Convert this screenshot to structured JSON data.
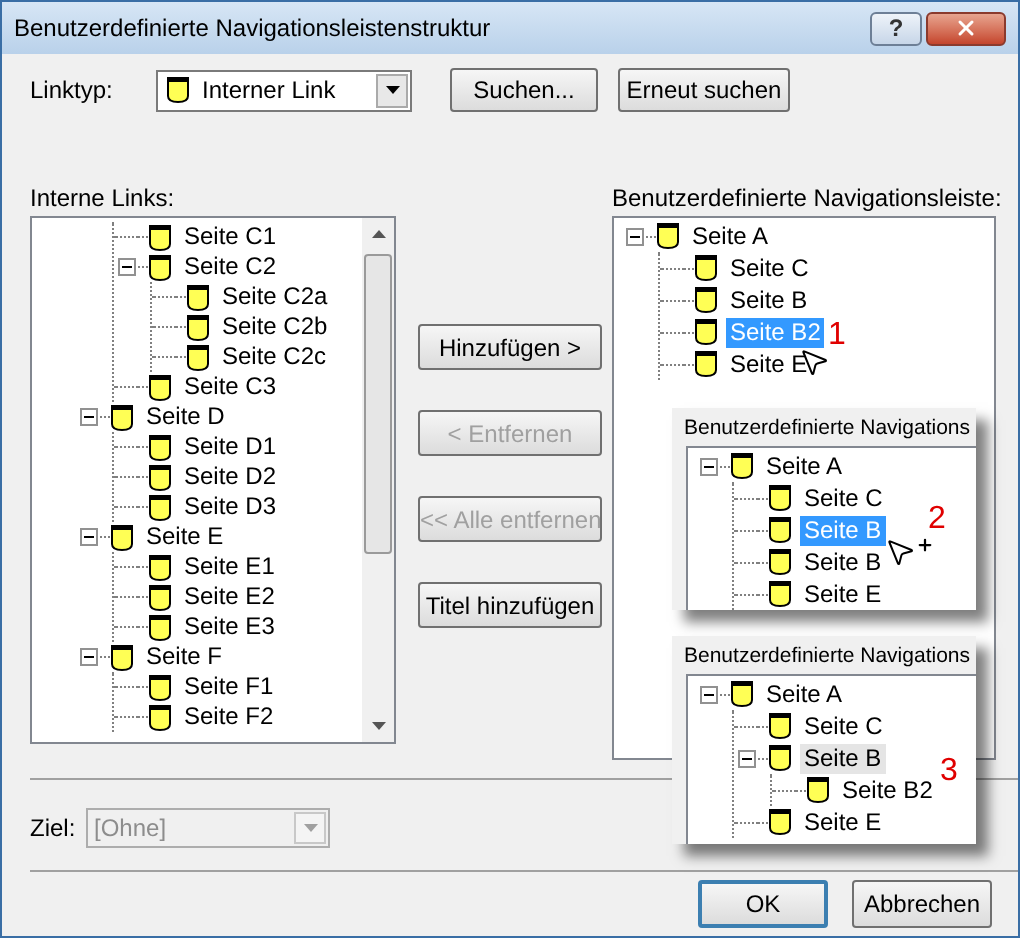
{
  "window": {
    "title": "Benutzerdefinierte Navigationsleistenstruktur",
    "help_button": "?"
  },
  "link_type": {
    "label": "Linktyp:",
    "value": "Interner Link"
  },
  "top_buttons": [
    "Suchen...",
    "Erneut suchen"
  ],
  "internal_links": {
    "label": "Interne Links:",
    "items": [
      {
        "children": [
          {
            "label": "Seite C1",
            "selected": false
          },
          {
            "label": "Seite C2",
            "selected": false,
            "expanded": true,
            "children": [
              {
                "label": "Seite C2a",
                "selected": false
              },
              {
                "label": "Seite C2b",
                "selected": false
              },
              {
                "label": "Seite C2c",
                "selected": false
              }
            ]
          },
          {
            "label": "Seite C3",
            "selected": false
          }
        ]
      },
      {
        "label": "Seite D",
        "selected": false,
        "expanded": true,
        "children": [
          {
            "label": "Seite D1",
            "selected": false
          },
          {
            "label": "Seite D2",
            "selected": false
          },
          {
            "label": "Seite D3",
            "selected": false
          }
        ]
      },
      {
        "label": "Seite E",
        "selected": false,
        "expanded": true,
        "children": [
          {
            "label": "Seite E1",
            "selected": false
          },
          {
            "label": "Seite E2",
            "selected": false
          },
          {
            "label": "Seite E3",
            "selected": false
          }
        ]
      },
      {
        "label": "Seite F",
        "selected": false,
        "expanded": true,
        "children": [
          {
            "label": "Seite F1",
            "selected": false
          },
          {
            "label": "Seite F2",
            "selected": false
          }
        ]
      }
    ]
  },
  "actions": [
    {
      "label": "Hinzufügen >",
      "disabled": false
    },
    {
      "label": "< Entfernen",
      "disabled": true
    },
    {
      "label": "<< Alle entfernen",
      "disabled": true
    },
    {
      "label": "Titel hinzufügen",
      "disabled": false
    }
  ],
  "custom_nav": {
    "label": "Benutzerdefinierte Navigationsleiste:",
    "step": "1",
    "items": [
      {
        "label": "Seite A",
        "selected": false,
        "expanded": true,
        "children": [
          {
            "label": "Seite C",
            "selected": false
          },
          {
            "label": "Seite B",
            "selected": false
          },
          {
            "label": "Seite B2",
            "selected": true
          },
          {
            "label": "Seite E",
            "selected": false
          }
        ]
      }
    ]
  },
  "insets": [
    {
      "label": "Benutzerdefinierte Navigations",
      "step": "2",
      "items": [
        {
          "label": "Seite A",
          "selected": false,
          "expanded": true,
          "children": [
            {
              "label": "Seite C",
              "selected": false
            },
            {
              "label": "Seite B",
              "selected": true
            },
            {
              "label": "Seite B",
              "selected": false
            },
            {
              "label": "Seite E",
              "selected": false
            }
          ]
        }
      ]
    },
    {
      "label": "Benutzerdefinierte Navigations",
      "step": "3",
      "items": [
        {
          "label": "Seite A",
          "selected": false,
          "highlighted": false,
          "expanded": true,
          "children": [
            {
              "label": "Seite C",
              "selected": false,
              "highlighted": false
            },
            {
              "label": "Seite B",
              "selected": false,
              "highlighted": true,
              "expanded": true,
              "children": [
                {
                  "label": "Seite B2",
                  "selected": false,
                  "highlighted": false
                }
              ]
            },
            {
              "label": "Seite E",
              "selected": false,
              "highlighted": false
            }
          ]
        }
      ]
    }
  ],
  "target": {
    "label": "Ziel:",
    "value": "[Ohne]",
    "disabled": true
  },
  "footer_buttons": [
    {
      "label": "OK",
      "default": true
    },
    {
      "label": "Abbrechen",
      "default": false
    }
  ]
}
